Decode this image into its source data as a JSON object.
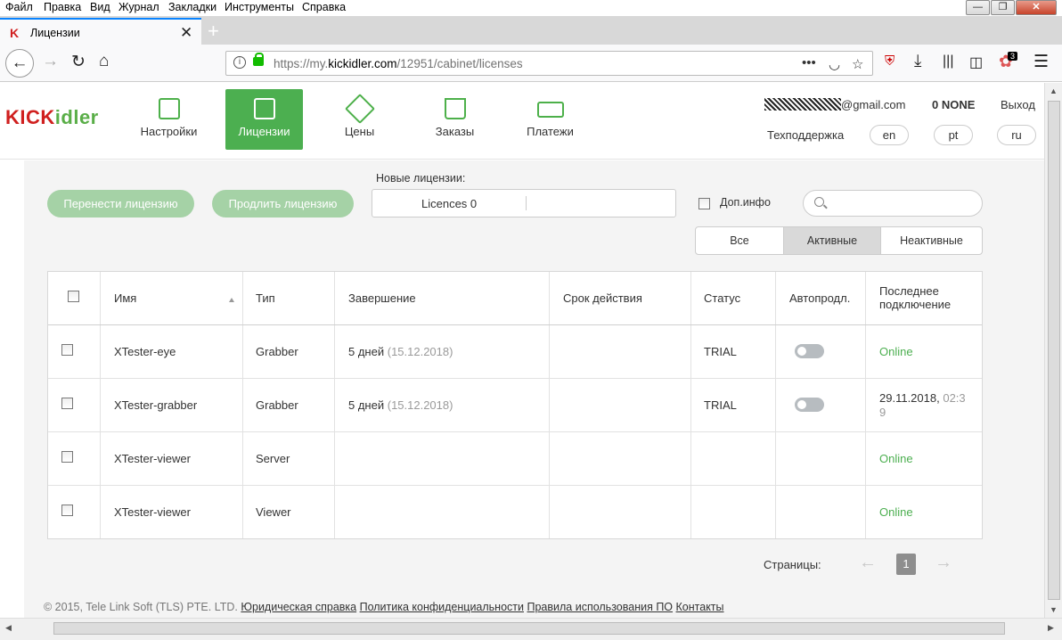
{
  "menu": [
    "Файл",
    "Правка",
    "Вид",
    "Журнал",
    "Закладки",
    "Инструменты",
    "Справка"
  ],
  "tab": {
    "title": "Лицензии",
    "close": "✕",
    "new": "+"
  },
  "window": {
    "minimize": "—",
    "maximize": "❐",
    "close": "✕"
  },
  "url": {
    "prefix": "https://my.",
    "host": "kickidler.com",
    "path": "/12951/cabinet/licenses"
  },
  "toolbar": {
    "more": "•••",
    "badge": "3",
    "menu": "☰"
  },
  "logo": {
    "part1": "KICK",
    "part2": "idler"
  },
  "nav": [
    {
      "label": "Настройки",
      "active": false
    },
    {
      "label": "Лицензии",
      "active": true
    },
    {
      "label": "Цены",
      "active": false
    },
    {
      "label": "Заказы",
      "active": false
    },
    {
      "label": "Платежи",
      "active": false
    }
  ],
  "account": {
    "email_suffix": "@gmail.com",
    "balance": "0 NONE",
    "logout": "Выход",
    "support": "Техподдержка",
    "langs": [
      "en",
      "pt",
      "ru"
    ]
  },
  "actions": {
    "transfer": "Перенести лицензию",
    "extend": "Продлить лицензию",
    "new_licenses_label": "Новые лицензии:",
    "new_licenses_value": "Licences 0",
    "extra_info": "Доп.инфо",
    "search_placeholder": ""
  },
  "filter": {
    "all": "Все",
    "active": "Активные",
    "inactive": "Неактивные"
  },
  "table": {
    "headers": {
      "name": "Имя",
      "type": "Тип",
      "expiry": "Завершение",
      "validity": "Срок действия",
      "status": "Статус",
      "autorenew": "Автопродл.",
      "last1": "Последнее",
      "last2": "подключение"
    },
    "rows": [
      {
        "name": "XTester-eye",
        "type": "Grabber",
        "expiry": "5 дней",
        "expiry_date": "(15.12.2018)",
        "status": "TRIAL",
        "toggle": true,
        "last": "Online",
        "last_time": ""
      },
      {
        "name": "XTester-grabber",
        "type": "Grabber",
        "expiry": "5 дней",
        "expiry_date": "(15.12.2018)",
        "status": "TRIAL",
        "toggle": true,
        "last": "29.11.2018,",
        "last_time": "02:3",
        "last_time2": "9"
      },
      {
        "name": "XTester-viewer",
        "type": "Server",
        "expiry": "",
        "expiry_date": "",
        "status": "",
        "toggle": false,
        "last": "Online"
      },
      {
        "name": "XTester-viewer",
        "type": "Viewer",
        "expiry": "",
        "expiry_date": "",
        "status": "",
        "toggle": false,
        "last": "Online"
      }
    ]
  },
  "pagination": {
    "label": "Страницы:",
    "prev": "←",
    "current": "1",
    "next": "→"
  },
  "footer": {
    "copyright": "© 2015, Tele Link Soft (TLS) PTE. LTD.",
    "links": [
      "Юридическая справка",
      "Политика конфиденциальности",
      "Правила использования ПО",
      "Контакты"
    ]
  },
  "colors": {
    "green": "#4caf50",
    "green_light": "#a5d2a6",
    "logo_red": "#d0201f",
    "tab_accent": "#0a84ff"
  }
}
